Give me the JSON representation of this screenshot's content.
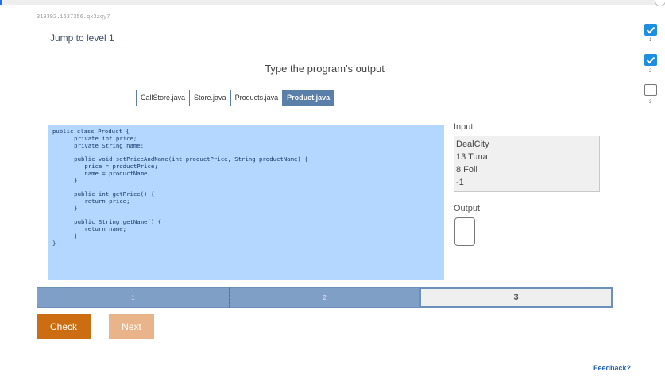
{
  "activity_id": "319392.1637356.qx3zqy7",
  "jump_link": "Jump to level 1",
  "prompt": "Type the program's output",
  "tabs": [
    {
      "label": "CallStore.java",
      "active": false
    },
    {
      "label": "Store.java",
      "active": false
    },
    {
      "label": "Products.java",
      "active": false
    },
    {
      "label": "Product.java",
      "active": true
    }
  ],
  "code": [
    "public class Product {",
    "   private int price;",
    "   private String name;",
    "",
    "   public void setPriceAndName(int productPrice, String productName) {",
    "      price = productPrice;",
    "      name = productName;",
    "   }",
    "",
    "   public int getPrice() {",
    "      return price;",
    "   }",
    "",
    "   public String getName() {",
    "      return name;",
    "   }",
    "}"
  ],
  "input": {
    "label": "Input",
    "lines": [
      "DealCity",
      "13 Tuna",
      "8 Foil",
      "-1"
    ]
  },
  "output": {
    "label": "Output",
    "value": ""
  },
  "levels": [
    {
      "label": "1",
      "state": "completed"
    },
    {
      "label": "2",
      "state": "completed"
    },
    {
      "label": "3",
      "state": "current"
    }
  ],
  "buttons": {
    "check": "Check",
    "next": "Next"
  },
  "feedback": "Feedback?",
  "progress": [
    {
      "number": "1",
      "done": true
    },
    {
      "number": "2",
      "done": true
    },
    {
      "number": "3",
      "done": false
    }
  ],
  "colors": {
    "code_background": "#b3d7fe",
    "level_completed": "#7f9fc7",
    "check_button": "#cc6d12",
    "next_button": "#e9b489",
    "progress_check": "#1e8fe0",
    "active_tab": "#5a7fa8"
  }
}
